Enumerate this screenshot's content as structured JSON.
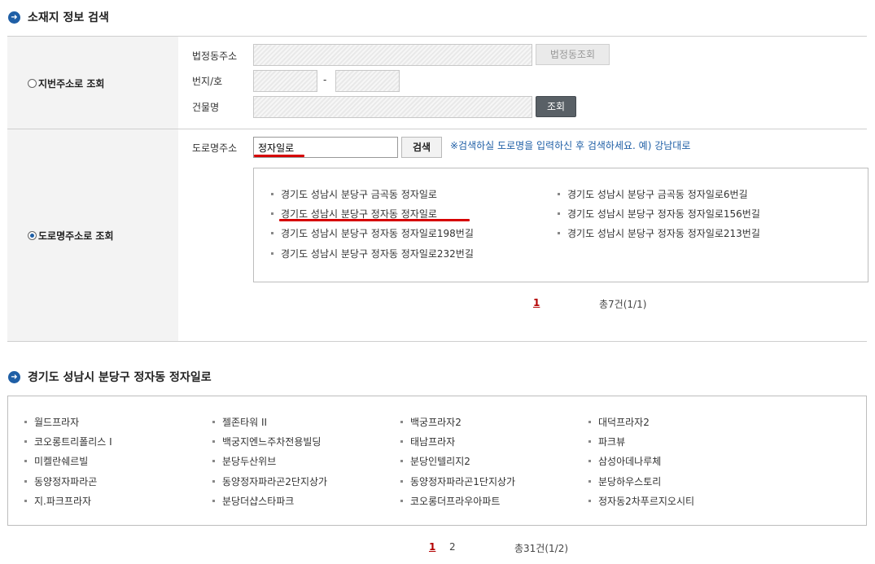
{
  "section1": {
    "title": "소재지 정보 검색"
  },
  "lot_search": {
    "radio_label": "지번주소로 조회",
    "legal_dong_label": "법정동주소",
    "legal_dong_button": "법정동조회",
    "lot_number_label": "번지/호",
    "separator": "-",
    "building_label": "건물명",
    "search_button": "조회"
  },
  "road_search": {
    "radio_label": "도로명주소로 조회",
    "road_label": "도로명주소",
    "input_value": "정자일로",
    "search_button": "검색",
    "hint": "※검색하실 도로명을 입력하신 후 검색하세요. 예) 강남대로",
    "results": [
      "경기도 성남시 분당구 금곡동 정자일로",
      "경기도 성남시 분당구 금곡동 정자일로6번길",
      "경기도 성남시 분당구 정자동 정자일로",
      "경기도 성남시 분당구 정자동 정자일로156번길",
      "경기도 성남시 분당구 정자동 정자일로198번길",
      "경기도 성남시 분당구 정자동 정자일로213번길",
      "경기도 성남시 분당구 정자동 정자일로232번길"
    ],
    "pagination": {
      "current": "1",
      "total": "총7건(1/1)"
    }
  },
  "section2": {
    "title": "경기도 성남시 분당구 정자동 정자일로",
    "buildings": [
      "월드프라자",
      "젤존타워 II",
      "백궁프라자2",
      "대덕프라자2",
      "코오롱트리폴리스 I",
      "백궁지엔느주차전용빌딩",
      "태남프라자",
      "파크뷰",
      "미켈란쉐르빌",
      "분당두산위브",
      "분당인텔리지2",
      "삼성아데나루체",
      "동양정자파라곤",
      "동양정자파라곤2단지상가",
      "동양정자파라곤1단지상가",
      "분당하우스토리",
      "지.파크프라자",
      "분당더샵스타파크",
      "코오롱더프라우아파트",
      "정자동2차푸르지오시티"
    ],
    "pagination": {
      "current": "1",
      "next": "2",
      "total": "총31건(1/2)"
    }
  },
  "colors": {
    "accent": "#1f5fa6",
    "highlight": "#d60000",
    "page_current": "#b30000"
  },
  "icons": {
    "section": "circle-arrow-right-icon"
  }
}
